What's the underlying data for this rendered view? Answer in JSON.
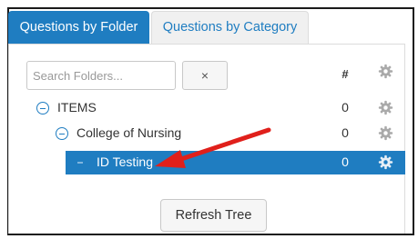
{
  "tabs": {
    "by_folder": "Questions by Folder",
    "by_category": "Questions by Category"
  },
  "search": {
    "placeholder": "Search Folders...",
    "clear_label": "×"
  },
  "header": {
    "count_label": "#",
    "settings_icon": "gear-icon"
  },
  "tree": {
    "items": [
      {
        "label": "ITEMS",
        "count": "0",
        "level": 0,
        "expanded": true,
        "selected": false
      },
      {
        "label": "College of Nursing",
        "count": "0",
        "level": 1,
        "expanded": true,
        "selected": false
      },
      {
        "label": "ID Testing",
        "count": "0",
        "level": 2,
        "expanded": false,
        "selected": true
      }
    ]
  },
  "refresh_label": "Refresh Tree",
  "colors": {
    "accent": "#1f7dc1",
    "annotation_arrow": "#e0201b",
    "gear": "#aaaaaa"
  }
}
